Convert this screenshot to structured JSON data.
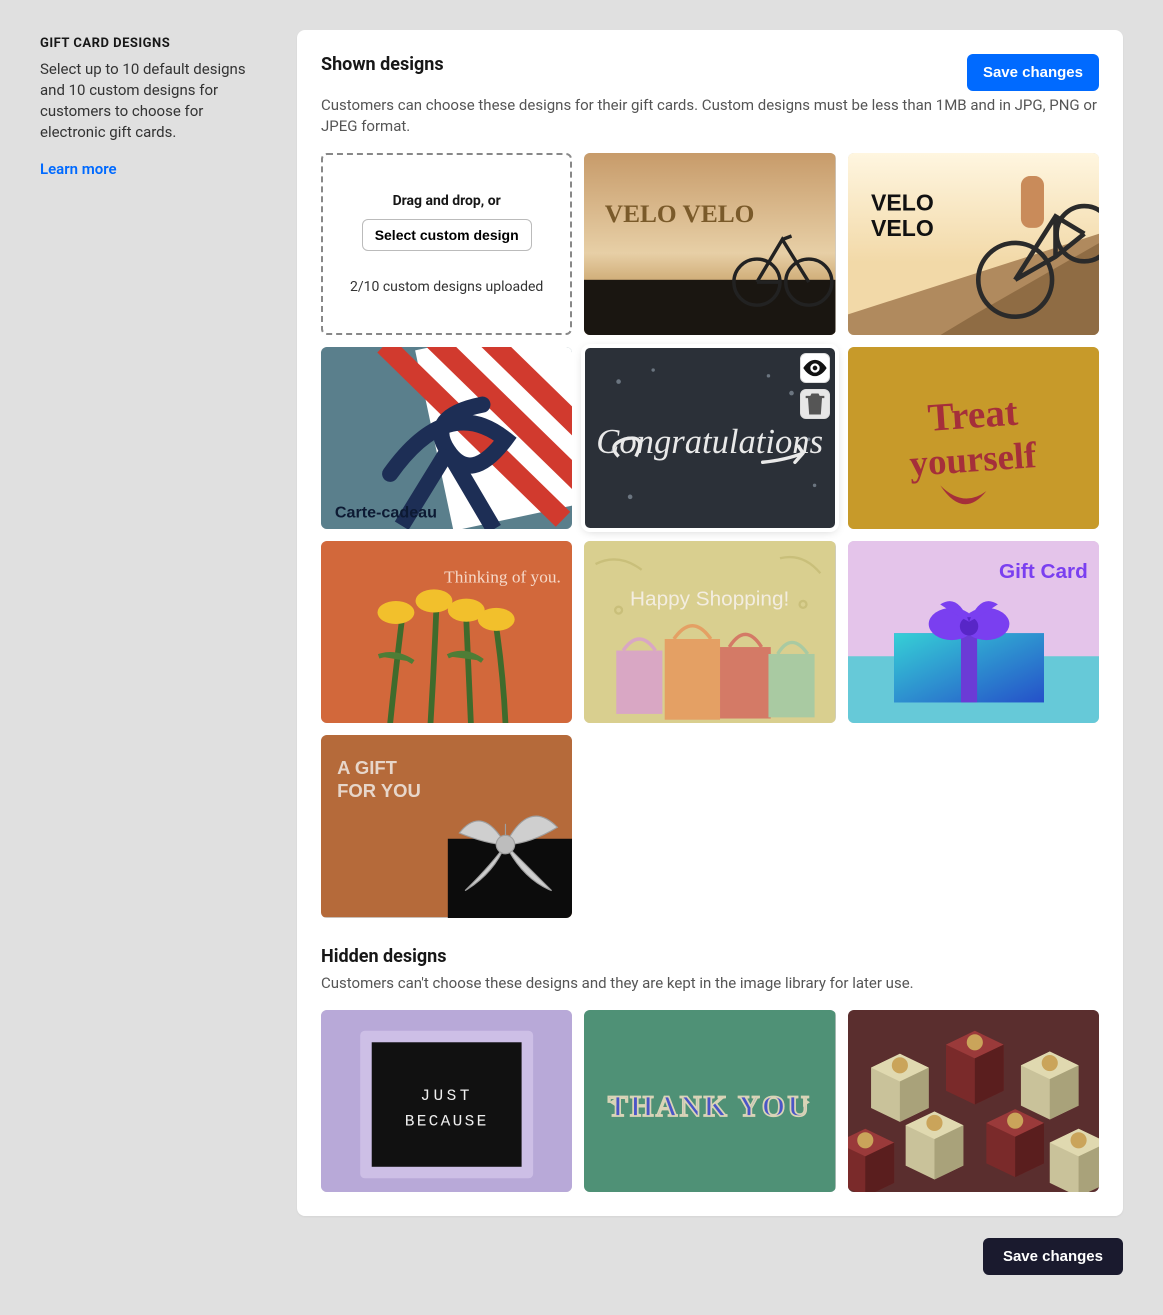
{
  "sidebar": {
    "title": "GIFT CARD DESIGNS",
    "description": "Select up to 10 default designs and 10 custom designs for customers to choose for electronic gift cards.",
    "learn_more": "Learn more"
  },
  "shown": {
    "title": "Shown designs",
    "description": "Customers can choose these designs for their gift cards. Custom designs must be less than 1MB and in JPG, PNG or JPEG format.",
    "save_button": "Save changes",
    "upload": {
      "drag_label": "Drag and drop, or",
      "button": "Select custom design",
      "count": "2/10 custom designs uploaded"
    },
    "cards": {
      "velo1": "VELO VELO",
      "velo2": "VELO VELO",
      "carte": "Carte-cadeau",
      "congrats": "Congratulations",
      "treat": "Treat yourself",
      "thinking": "Thinking of you.",
      "happy": "Happy Shopping!",
      "giftcard": "Gift Card",
      "giftforyou": "A GIFT FOR YOU"
    }
  },
  "hidden": {
    "title": "Hidden designs",
    "description": "Customers can't choose these designs and they are kept in the image library for later use.",
    "cards": {
      "just": "JUST BECAUSE",
      "thankyou": "THANK YOU"
    }
  },
  "footer": {
    "save_button": "Save changes"
  }
}
